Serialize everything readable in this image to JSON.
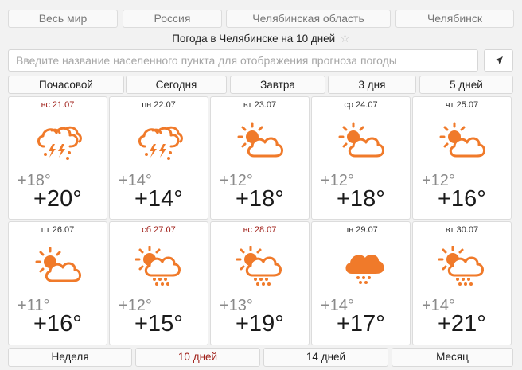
{
  "nav": {
    "items": [
      "Весь мир",
      "Россия",
      "Челябинская область",
      "Челябинск"
    ]
  },
  "header": {
    "title": "Погода в Челябинске на 10 дней",
    "star": "☆"
  },
  "search": {
    "placeholder": "Введите название населенного пункта для отображения прогноза погоды"
  },
  "period_tabs": [
    "Почасовой",
    "Сегодня",
    "Завтра",
    "3 дня",
    "5 дней"
  ],
  "days": [
    {
      "date": "вс 21.07",
      "weekend": true,
      "icon": "thunderstorm-icon",
      "tmin": "+18°",
      "tmax": "+20°"
    },
    {
      "date": "пн 22.07",
      "weekend": false,
      "icon": "thunderstorm-icon",
      "tmin": "+14°",
      "tmax": "+14°"
    },
    {
      "date": "вт 23.07",
      "weekend": false,
      "icon": "partly-cloudy-icon",
      "tmin": "+12°",
      "tmax": "+18°"
    },
    {
      "date": "ср 24.07",
      "weekend": false,
      "icon": "partly-cloudy-icon",
      "tmin": "+12°",
      "tmax": "+18°"
    },
    {
      "date": "чт 25.07",
      "weekend": false,
      "icon": "partly-cloudy-icon",
      "tmin": "+12°",
      "tmax": "+16°"
    },
    {
      "date": "пт 26.07",
      "weekend": false,
      "icon": "partly-cloudy-icon",
      "tmin": "+11°",
      "tmax": "+16°"
    },
    {
      "date": "сб 27.07",
      "weekend": true,
      "icon": "sun-cloud-rain-icon",
      "tmin": "+12°",
      "tmax": "+15°"
    },
    {
      "date": "вс 28.07",
      "weekend": true,
      "icon": "sun-cloud-rain-icon",
      "tmin": "+13°",
      "tmax": "+19°"
    },
    {
      "date": "пн 29.07",
      "weekend": false,
      "icon": "cloud-rain-icon",
      "tmin": "+14°",
      "tmax": "+17°"
    },
    {
      "date": "вт 30.07",
      "weekend": false,
      "icon": "sun-cloud-rain-icon",
      "tmin": "+14°",
      "tmax": "+21°"
    }
  ],
  "range_tabs": [
    "Неделя",
    "10 дней",
    "14 дней",
    "Месяц"
  ],
  "active_range": "10 дней",
  "colors": {
    "icon": "#f07a2a",
    "weekend": "#a0201a"
  }
}
